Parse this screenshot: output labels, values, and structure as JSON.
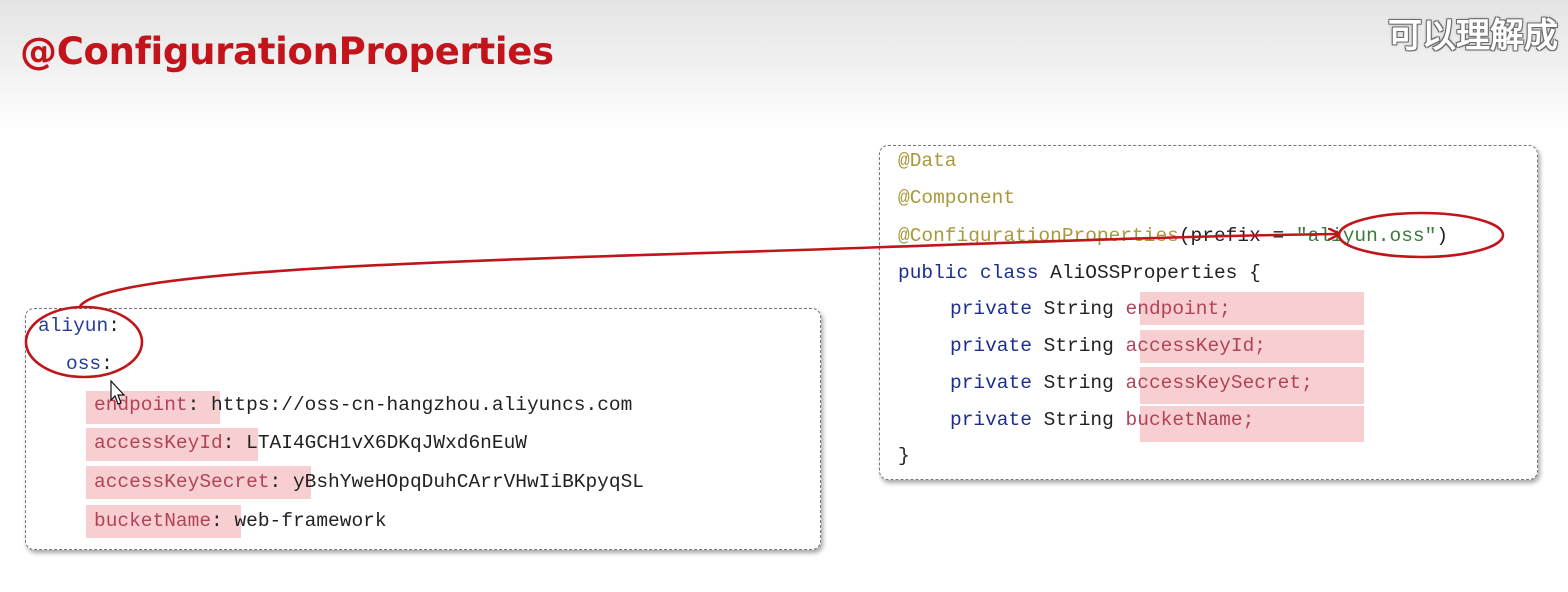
{
  "slide": {
    "title": "@ConfigurationProperties",
    "subtitle": "可以理解成"
  },
  "yaml": {
    "root_key": "aliyun",
    "sub_key": "oss",
    "colon": ":",
    "entries": [
      {
        "key": "endpoint",
        "value": "https://oss-cn-hangzhou.aliyuncs.com"
      },
      {
        "key": "accessKeyId",
        "value": "LTAI4GCH1vX6DKqJWxd6nEuW"
      },
      {
        "key": "accessKeySecret",
        "value": "yBshYweHOpqDuhCArrVHwIiBKpyqSL"
      },
      {
        "key": "bucketName",
        "value": "web-framework"
      }
    ]
  },
  "java": {
    "annotation_data": "@Data",
    "annotation_component": "@Component",
    "annotation_config": "@ConfigurationProperties",
    "prefix_open": "(prefix = ",
    "prefix_value": "\"aliyun.oss\"",
    "prefix_close": ")",
    "class_decl": {
      "modifier": "public class",
      "name": "AliOSSProperties",
      "brace": "{"
    },
    "field_modifier": "private",
    "field_type": "String",
    "fields": [
      "endpoint;",
      "accessKeyId;",
      "accessKeySecret;",
      "bucketName;"
    ],
    "closing_brace": "}"
  },
  "colors": {
    "title_red": "#c2141a",
    "annotation_circle": "#c0161b",
    "highlight_pink": "#f8cfd0",
    "keyword_blue": "#1c2f8c",
    "annotation_olive": "#a89a3c"
  }
}
